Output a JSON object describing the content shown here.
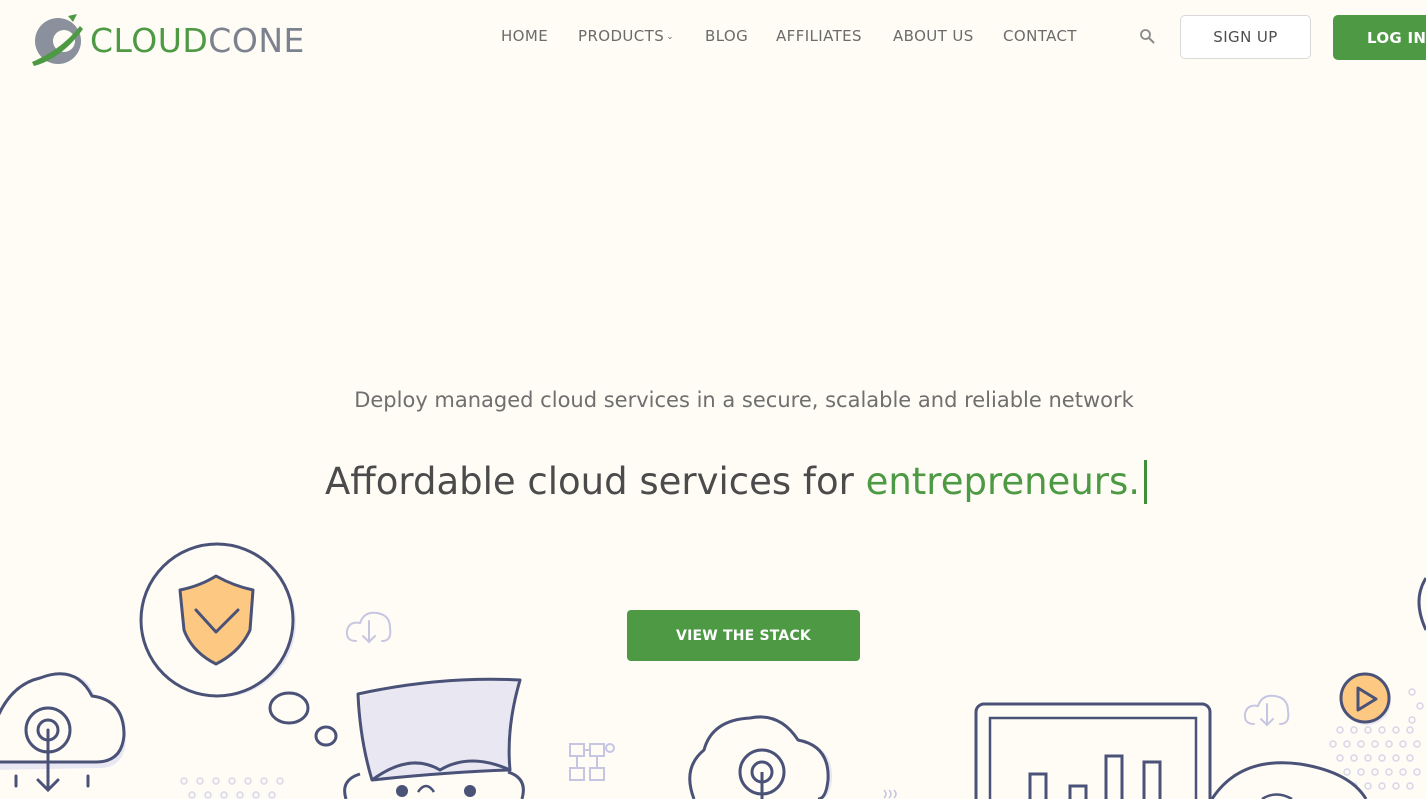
{
  "brand": {
    "name_part1": "CLOUD",
    "name_part2": "CONE",
    "logo_icon": "cloudcone-logo-icon"
  },
  "nav": {
    "items": [
      {
        "label": "HOME"
      },
      {
        "label": "PRODUCTS",
        "has_dropdown": true
      },
      {
        "label": "BLOG"
      },
      {
        "label": "AFFILIATES"
      },
      {
        "label": "ABOUT US"
      },
      {
        "label": "CONTACT"
      }
    ],
    "search_icon": "search-icon",
    "dropdown_icon": "chevron-down-icon"
  },
  "auth": {
    "signup_label": "SIGN UP",
    "login_label": "LOG IN"
  },
  "hero": {
    "subtitle": "Deploy managed cloud services in a secure, scalable and reliable network",
    "title_prefix": "Affordable cloud services for ",
    "title_highlight": "entrepreneurs.",
    "cta_label": "VIEW THE STACK"
  },
  "colors": {
    "background": "#fefcf5",
    "accent_green": "#4e9a44",
    "outline_navy": "#4a5278",
    "highlight_orange": "#fdc982",
    "muted_lavender": "#c7c6e2"
  }
}
